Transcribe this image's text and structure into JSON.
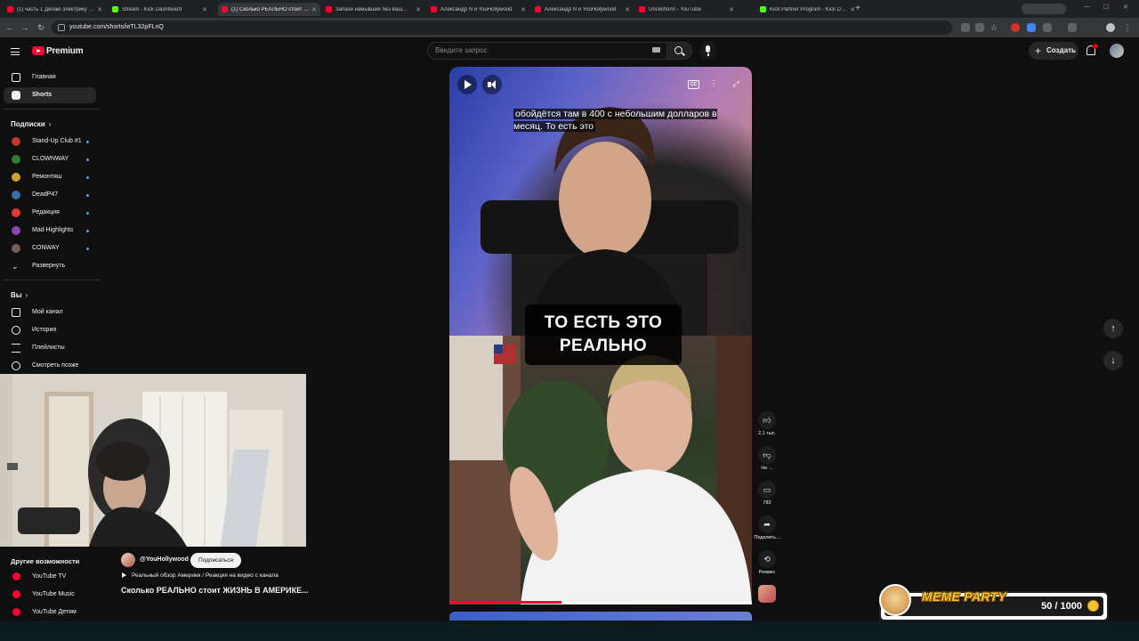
{
  "browser": {
    "tabs": [
      {
        "title": "(1) часть 1 Делаю электрику у...",
        "favicon": "yt"
      },
      {
        "title": "Stream - Kick Dashboard",
        "favicon": "kick"
      },
      {
        "title": "(1) Сколько РЕАЛЬНО стоит Ж...",
        "favicon": "yt"
      },
      {
        "title": "Запахи намывших без ваш...",
        "favicon": "yt"
      },
      {
        "title": "Александр N и YouHollywood",
        "favicon": "yt"
      },
      {
        "title": "Александр N и YouHollywood",
        "favicon": "yt"
      },
      {
        "title": "Unclelhonn - YouTube",
        "favicon": "yt"
      },
      {
        "title": "Kick Partner Program - Kick De...",
        "favicon": "kick"
      }
    ],
    "tab_close": "✕",
    "new_tab": "+",
    "url": "youtube.com/shorts/ieTL32pFLnQ",
    "nav": {
      "back": "←",
      "forward": "→",
      "reload": "↻"
    }
  },
  "header": {
    "brand": "Premium",
    "search_placeholder": "Введите запрос",
    "create_label": "Создать"
  },
  "sidebar": {
    "main": [
      {
        "label": "Главная"
      },
      {
        "label": "Shorts"
      }
    ],
    "subscriptions_title": "Подписки",
    "subscriptions": [
      {
        "label": "Stand-Up Club #1",
        "color": "#c0392b"
      },
      {
        "label": "CLOWNWAY",
        "color": "#2e7d32"
      },
      {
        "label": "Ремонтяш",
        "color": "#c9a227"
      },
      {
        "label": "DeadP47",
        "color": "#3a6ea5"
      },
      {
        "label": "Редакция",
        "color": "#e53935"
      },
      {
        "label": "Mad Highlights",
        "color": "#8e44ad"
      },
      {
        "label": "CONWAY",
        "color": "#7b5e57"
      }
    ],
    "expand_label": "Развернуть",
    "you_title": "Вы",
    "you": [
      {
        "label": "Мой канал"
      },
      {
        "label": "История"
      },
      {
        "label": "Плейлисты"
      },
      {
        "label": "Смотреть позже"
      }
    ],
    "more_title": "Другие возможности",
    "more": [
      {
        "label": "YouTube TV"
      },
      {
        "label": "YouTube Music"
      },
      {
        "label": "YouTube Детям"
      }
    ]
  },
  "short": {
    "caption_top": "обойдётся там в 400 с небольшим долларов в месяц. То есть это",
    "caption_main_line1": "ТО ЕСТЬ ЭТО",
    "caption_main_line2": "РЕАЛЬНО",
    "cc_label": "CC",
    "progress": 0.37,
    "channel": "@YouHollywood",
    "subscribe_label": "Подписаться",
    "playlist": "Реальный обзор Америки / Реакция на видео с канала",
    "title": "Сколько РЕАЛЬНО стоит ЖИЗНЬ В АМЕРИКЕ..."
  },
  "actions": {
    "likes": "2,1 тыс.",
    "dislike": "Не ...",
    "comments": "783",
    "share": "Поделить...",
    "remix": "Ремикс"
  },
  "widget": {
    "title": "MEME PARTY",
    "count": "50 / 1000"
  }
}
